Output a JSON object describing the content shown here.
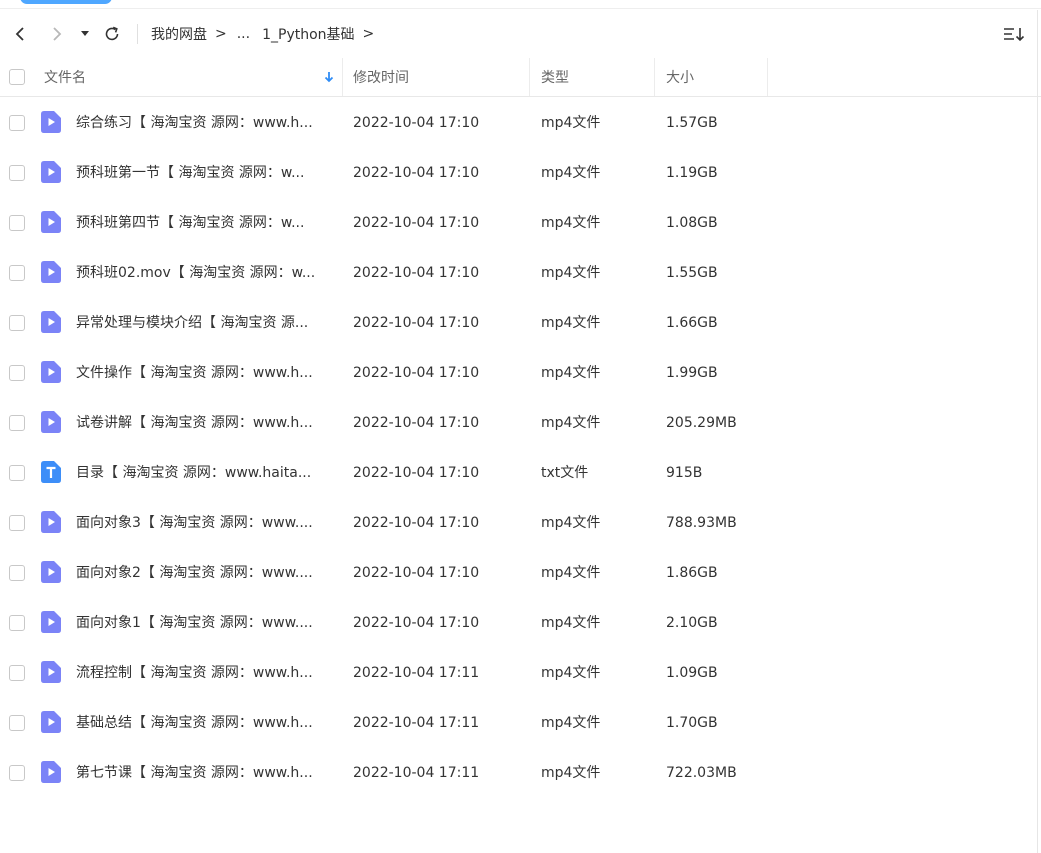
{
  "toolbar": {
    "breadcrumb": [
      "我的网盘",
      ">",
      "...",
      "1_Python基础",
      ">"
    ]
  },
  "header": {
    "name": "文件名",
    "modified": "修改时间",
    "type": "类型",
    "size": "大小"
  },
  "colors": {
    "video_icon": "#7b83f7",
    "txt_icon": "#3d8ef8",
    "sort_arrow": "#2f8cf6"
  },
  "files": [
    {
      "name": "综合练习【 海淘宝资 源网：www.h...",
      "modified": "2022-10-04 17:10",
      "type": "mp4文件",
      "size": "1.57GB",
      "icon": "video-icon"
    },
    {
      "name": "预科班第一节【 海淘宝资 源网：w...",
      "modified": "2022-10-04 17:10",
      "type": "mp4文件",
      "size": "1.19GB",
      "icon": "video-icon"
    },
    {
      "name": "预科班第四节【 海淘宝资 源网：w...",
      "modified": "2022-10-04 17:10",
      "type": "mp4文件",
      "size": "1.08GB",
      "icon": "video-icon"
    },
    {
      "name": "预科班02.mov【 海淘宝资 源网：w...",
      "modified": "2022-10-04 17:10",
      "type": "mp4文件",
      "size": "1.55GB",
      "icon": "video-icon"
    },
    {
      "name": "异常处理与模块介绍【 海淘宝资 源...",
      "modified": "2022-10-04 17:10",
      "type": "mp4文件",
      "size": "1.66GB",
      "icon": "video-icon"
    },
    {
      "name": "文件操作【 海淘宝资 源网：www.h...",
      "modified": "2022-10-04 17:10",
      "type": "mp4文件",
      "size": "1.99GB",
      "icon": "video-icon"
    },
    {
      "name": "试卷讲解【 海淘宝资 源网：www.h...",
      "modified": "2022-10-04 17:10",
      "type": "mp4文件",
      "size": "205.29MB",
      "icon": "video-icon"
    },
    {
      "name": "目录【 海淘宝资 源网：www.haita...",
      "modified": "2022-10-04 17:10",
      "type": "txt文件",
      "size": "915B",
      "icon": "txt-icon"
    },
    {
      "name": "面向对象3【 海淘宝资 源网：www....",
      "modified": "2022-10-04 17:10",
      "type": "mp4文件",
      "size": "788.93MB",
      "icon": "video-icon"
    },
    {
      "name": "面向对象2【 海淘宝资 源网：www....",
      "modified": "2022-10-04 17:10",
      "type": "mp4文件",
      "size": "1.86GB",
      "icon": "video-icon"
    },
    {
      "name": "面向对象1【 海淘宝资 源网：www....",
      "modified": "2022-10-04 17:10",
      "type": "mp4文件",
      "size": "2.10GB",
      "icon": "video-icon"
    },
    {
      "name": "流程控制【 海淘宝资 源网：www.h...",
      "modified": "2022-10-04 17:11",
      "type": "mp4文件",
      "size": "1.09GB",
      "icon": "video-icon"
    },
    {
      "name": "基础总结【 海淘宝资 源网：www.h...",
      "modified": "2022-10-04 17:11",
      "type": "mp4文件",
      "size": "1.70GB",
      "icon": "video-icon"
    },
    {
      "name": "第七节课【 海淘宝资 源网：www.h...",
      "modified": "2022-10-04 17:11",
      "type": "mp4文件",
      "size": "722.03MB",
      "icon": "video-icon"
    }
  ]
}
